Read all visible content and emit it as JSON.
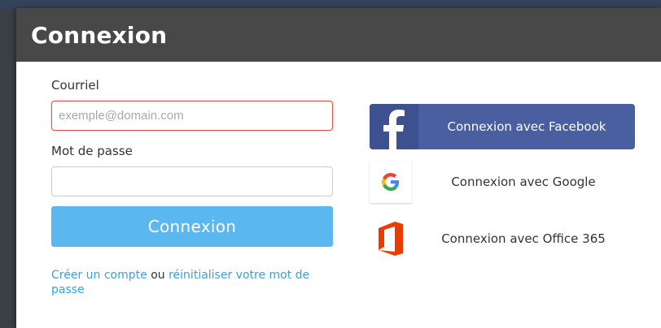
{
  "modal": {
    "title": "Connexion"
  },
  "form": {
    "email_label": "Courriel",
    "email_placeholder": "exemple@domain.com",
    "email_value": "",
    "password_label": "Mot de passe",
    "password_value": "",
    "submit_label": "Connexion",
    "create_account_link": "Créer un compte",
    "or_text": "ou",
    "reset_password_link": "réinitialiser votre mot de passe"
  },
  "social": {
    "facebook_label": "Connexion avec Facebook",
    "facebook_icon": "facebook-icon",
    "google_label": "Connexion avec Google",
    "google_icon": "google-icon",
    "office_label": "Connexion avec Office 365",
    "office_icon": "office-365-icon"
  },
  "colors": {
    "header": "#484848",
    "primary_button": "#5bb7f0",
    "link": "#3aa0e0",
    "facebook": "#4a5fa0",
    "error_border": "#d9534f",
    "office": "#eb3c00"
  }
}
